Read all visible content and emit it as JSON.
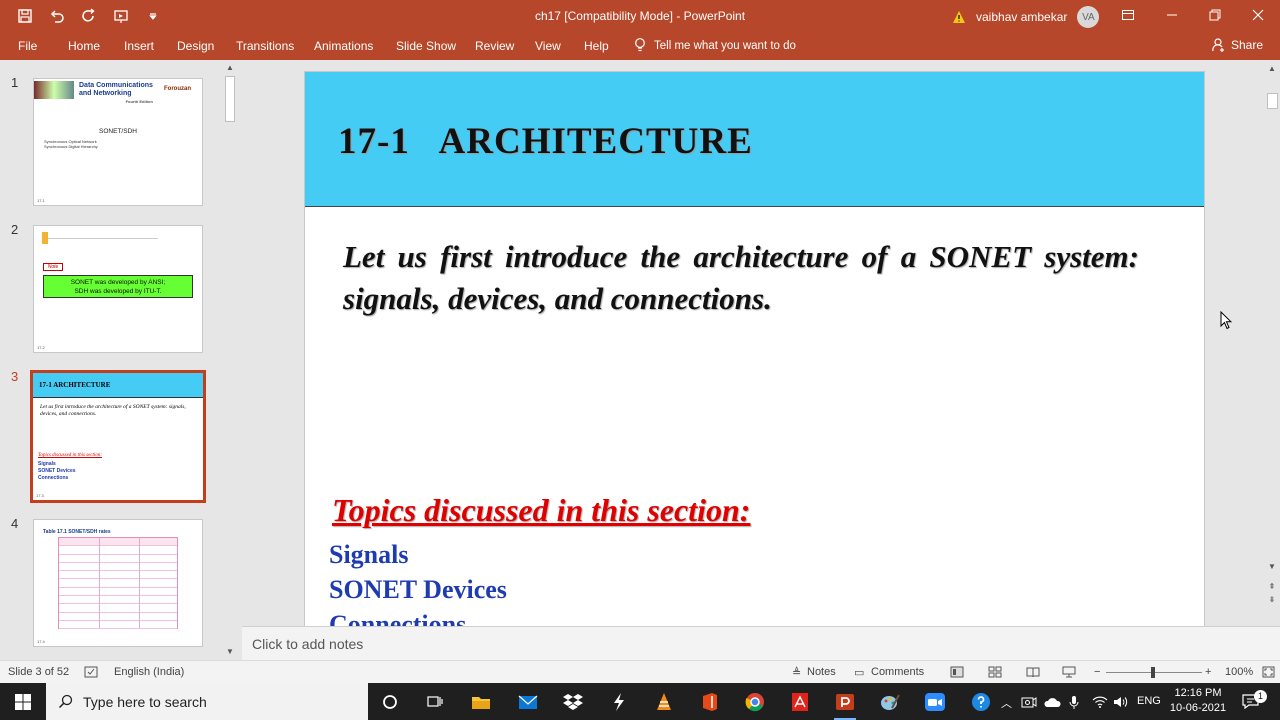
{
  "window": {
    "title": "ch17 [Compatibility Mode]  -  PowerPoint",
    "user_name": "vaibhav ambekar",
    "user_initials": "VA"
  },
  "ribbon": {
    "tabs": [
      "File",
      "Home",
      "Insert",
      "Design",
      "Transitions",
      "Animations",
      "Slide Show",
      "Review",
      "View",
      "Help"
    ],
    "tell_me": "Tell me what you want to do",
    "share": "Share"
  },
  "thumbnails": [
    {
      "number": "1",
      "book_title_line1": "Data Communications",
      "book_title_line2": "and Networking",
      "edition": "Fourth Edition",
      "author": "Forouzan",
      "main": "SONET/SDH",
      "sub1": "Synchronous Optical Network",
      "sub2": "Synchronous Digital Hierarchy",
      "footer": "17.1"
    },
    {
      "number": "2",
      "badge": "Note",
      "box_line1": "SONET was developed by ANSI;",
      "box_line2": "SDH was developed by ITU-T.",
      "footer": "17.2"
    },
    {
      "number": "3",
      "title": "17-1  ARCHITECTURE",
      "body": "Let us first introduce the architecture of a SONET system: signals, devices, and connections.",
      "topics": "Topics discussed in this section:",
      "items": [
        "Signals",
        "SONET Devices",
        "Connections"
      ],
      "footer": "17.3"
    },
    {
      "number": "4",
      "caption": "Table 17.1  SONET/SDH rates",
      "footer": "17.4"
    }
  ],
  "slide": {
    "title": "17-1   ARCHITECTURE",
    "body": "Let us first introduce the architecture of a SONET system: signals, devices, and connections.",
    "topics_heading": "Topics discussed in this section:",
    "topics": [
      "Signals",
      "SONET Devices",
      "Connections"
    ]
  },
  "notes_placeholder": "Click to add notes",
  "status": {
    "slide_counter": "Slide 3 of 52",
    "language": "English (India)",
    "notes": "Notes",
    "comments": "Comments",
    "zoom": "100%"
  },
  "taskbar": {
    "search_placeholder": "Type here to search",
    "language": "ENG",
    "time": "12:16 PM",
    "date": "10-06-2021"
  },
  "colors": {
    "accent": "#b7472a",
    "slide_header": "#44ccf5",
    "topics_red": "#e00000",
    "topic_blue": "#1f3bb0"
  }
}
